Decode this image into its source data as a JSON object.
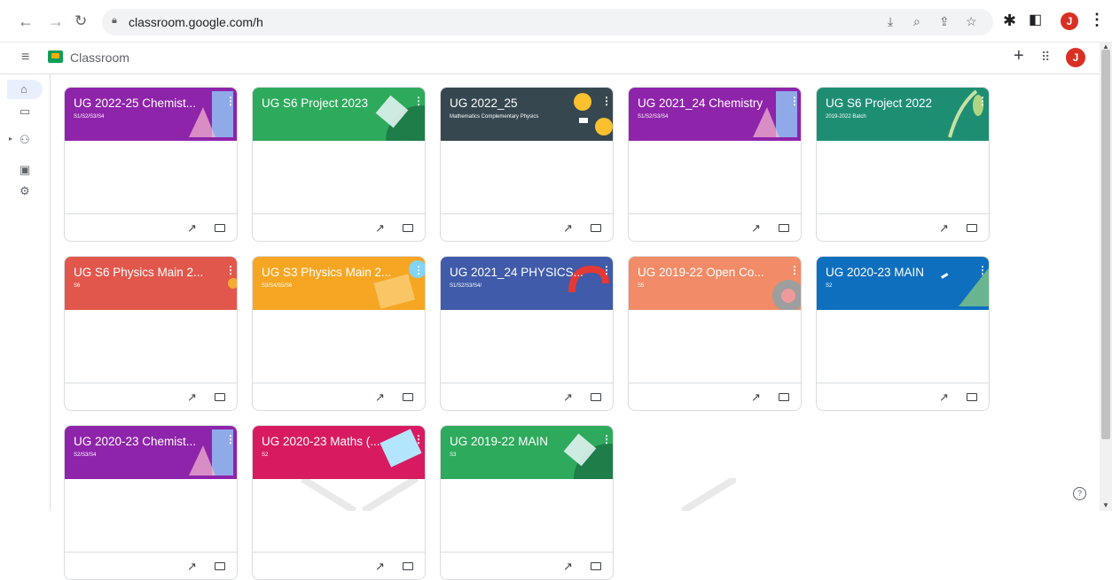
{
  "browser": {
    "url": "classroom.google.com/h",
    "profile_initial": "J"
  },
  "app": {
    "title": "Classroom",
    "avatar_initial": "J"
  },
  "icons": {
    "back": "arrow-left-icon",
    "forward": "arrow-right-icon",
    "reload": "reload-icon",
    "lock": "lock-icon",
    "install": "install-icon",
    "zoom": "zoom-icon",
    "share": "share-icon",
    "bookmark": "star-icon",
    "extensions": "puzzle-icon",
    "sidepanel": "side-panel-icon",
    "menu": "three-dots-icon",
    "hamburger": "hamburger-icon",
    "add": "plus-icon",
    "apps": "apps-grid-icon",
    "home": "home-icon",
    "calendar": "calendar-icon",
    "enrolled": "people-icon",
    "archive": "archive-icon",
    "settings": "gear-icon",
    "help": "help-icon",
    "trend": "trending-icon",
    "folder": "folder-icon"
  },
  "courses": [
    {
      "title": "UG 2022-25 Chemist...",
      "subtitle": "S1/S2/S3/S4",
      "color": "#8e24aa"
    },
    {
      "title": "UG S6 Project 2023",
      "subtitle": "",
      "color": "#2eaa5c"
    },
    {
      "title": "UG 2022_25",
      "subtitle": "Mathematics Complementary Physics",
      "color": "#37474f"
    },
    {
      "title": "UG 2021_24 Chemistry",
      "subtitle": "S1/S2/S3/S4",
      "color": "#8e24aa"
    },
    {
      "title": "UG S6 Project 2022",
      "subtitle": "2019-2022 Batch",
      "color": "#1e8e73"
    },
    {
      "title": "UG S6 Physics Main 2...",
      "subtitle": "S6",
      "color": "#e2574c"
    },
    {
      "title": "UG S3 Physics Main 2...",
      "subtitle": "S3/S4/S5/S6",
      "color": "#f6a623"
    },
    {
      "title": "UG 2021_24 PHYSICS...",
      "subtitle": "S1/S2/S3/S4/",
      "color": "#3f5ba9"
    },
    {
      "title": "UG 2019-22 Open Co...",
      "subtitle": "S5",
      "color": "#f28b67"
    },
    {
      "title": "UG 2020-23 MAIN",
      "subtitle": "S2",
      "color": "#0f6fbf"
    },
    {
      "title": "UG 2020-23 Chemist...",
      "subtitle": "S2/S3/S4",
      "color": "#8e24aa"
    },
    {
      "title": "UG 2020-23 Maths (...",
      "subtitle": "S2",
      "color": "#d81b60"
    },
    {
      "title": "UG 2019-22 MAIN",
      "subtitle": "S3",
      "color": "#2eaa5c"
    }
  ]
}
